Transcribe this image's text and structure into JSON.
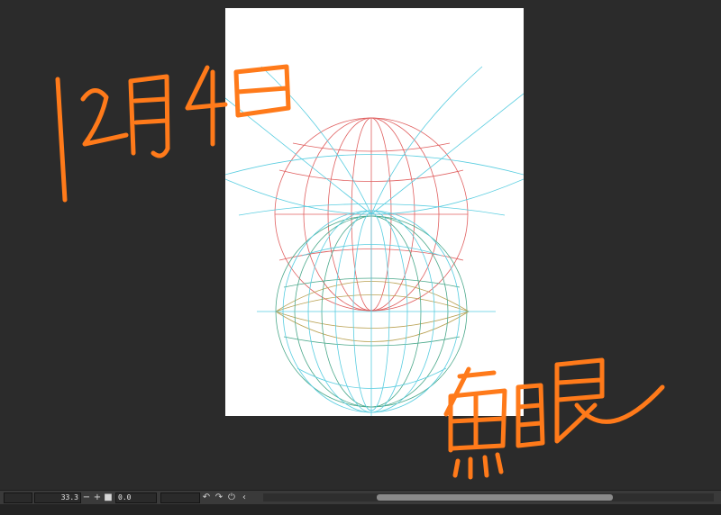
{
  "statusbar": {
    "zoom_value": "33.3",
    "zoom_out_glyph": "−",
    "zoom_in_glyph": "+",
    "fit_glyph": "■",
    "rotation_value": "0.0",
    "rotate_left_glyph": "↶",
    "rotate_right_glyph": "↷",
    "reset_glyph": "⏻",
    "collapse_glyph": "‹"
  },
  "handwriting": {
    "date": "12月4日",
    "title": "魚眼"
  },
  "colors": {
    "workspace_bg": "#2b2b2b",
    "ink_orange": "#ff7a1a",
    "guide_red": "#e06060",
    "guide_cyan": "#59cde0",
    "guide_green": "#4aa88a",
    "guide_olive": "#b8a050"
  },
  "icons": {
    "zoom_out": "minus-icon",
    "zoom_in": "plus-icon",
    "fit": "square-icon",
    "rotate_left": "rotate-left-icon",
    "rotate_right": "rotate-right-icon",
    "reset_rotation": "reset-icon",
    "collapse": "chevron-left-icon"
  }
}
